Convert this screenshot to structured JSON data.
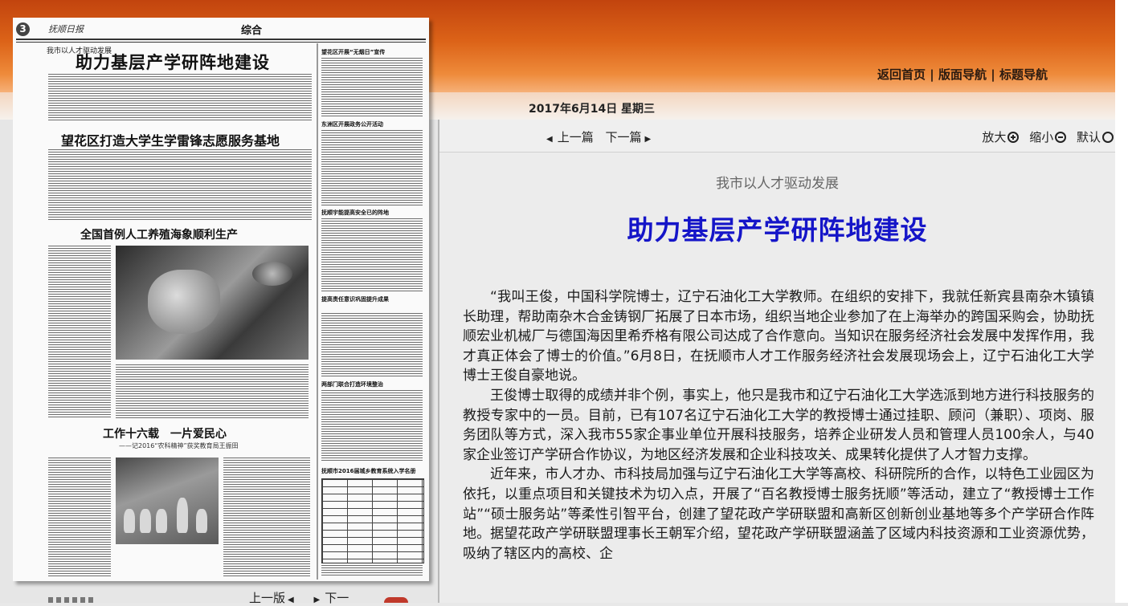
{
  "header": {
    "nav_links": [
      "返回首页",
      "版面导航",
      "标题导航"
    ],
    "separator": "|",
    "date": "2017年6月14日 星期三"
  },
  "navbar": {
    "prev_label": "上一篇",
    "next_label": "下一篇",
    "zoom_in_label": "放大",
    "zoom_out_label": "缩小",
    "default_label": "默认"
  },
  "article": {
    "subtitle": "我市以人才驱动发展",
    "title": "助力基层产学研阵地建设",
    "paragraphs": [
      "“我叫王俊，中国科学院博士，辽宁石油化工大学教师。在组织的安排下，我就任新宾县南杂木镇镇长助理，帮助南杂木合金铸钢厂拓展了日本市场，组织当地企业参加了在上海举办的跨国采购会，协助抚顺宏业机械厂与德国海因里希乔格有限公司达成了合作意向。当知识在服务经济社会发展中发挥作用，我才真正体会了博士的价值。”6月8日，在抚顺市人才工作服务经济社会发展现场会上，辽宁石油化工大学博士王俊自豪地说。",
      "王俊博士取得的成绩并非个例，事实上，他只是我市和辽宁石油化工大学选派到地方进行科技服务的教授专家中的一员。目前，已有107名辽宁石油化工大学的教授博士通过挂职、顾问（兼职）、项岗、服务团队等方式，深入我市55家企事业单位开展科技服务，培养企业研发人员和管理人员100余人，与40家企业签订产学研合作协议，为地区经济发展和企业科技攻关、成果转化提供了人才智力支撑。",
      "近年来，市人才办、市科技局加强与辽宁石油化工大学等高校、科研院所的合作，以特色工业园区为依托，以重点项目和关键技术为切入点，开展了“百名教授博士服务抚顺”等活动，建立了“教授博士工作站”“硕士服务站”等柔性引智平台，创建了望花政产学研联盟和高新区创新创业基地等多个产学研合作阵地。据望花政产学研联盟理事长王朝军介绍，望花政产学研联盟涵盖了区域内科技资源和工业资源优势，吸纳了辖区内的高校、企"
    ]
  },
  "newspaper": {
    "page_number": "3",
    "masthead": "抚顺日报",
    "section": "综合",
    "kicker": "我市以人才驱动发展",
    "headlines": [
      "助力基层产学研阵地建设",
      "望花区打造大学生学雷锋志愿服务基地",
      "全国首例人工养殖海象顺利生产",
      "工作十六载　一片爱民心"
    ],
    "sub_headline": "——记2016“农科精神”获奖教育局王振田",
    "side_headlines": [
      "望花区开展“无烟日”宣传",
      "东洲区开展政务公开活动",
      "抚顺宇能提高安全已的阵地",
      "提高责任意识巩固提升成果",
      "两部门联合打造环境整治",
      "抚顺市2016届城乡教育系统入学名册"
    ]
  },
  "bottom": {
    "prev": "上一版",
    "next": "下一"
  }
}
